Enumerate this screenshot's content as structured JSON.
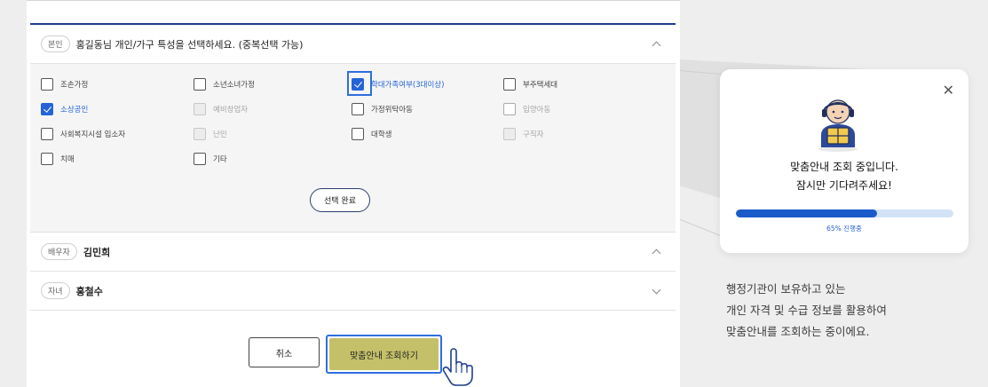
{
  "colors": {
    "accent": "#2563d9",
    "primary_button": "#c4c06a",
    "progress_fill": "#1a5bc9",
    "progress_track": "#d3e2f7"
  },
  "section1": {
    "tag": "본인",
    "title": "홍길동님 개인/가구 특성을 선택하세요. (중복선택 가능)",
    "options": [
      {
        "label": "조손가정",
        "checked": false,
        "disabled": false
      },
      {
        "label": "소년소녀가정",
        "checked": false,
        "disabled": false
      },
      {
        "label": "학대가족여부(3대이상)",
        "checked": true,
        "disabled": false
      },
      {
        "label": "부주택세대",
        "checked": false,
        "disabled": false
      },
      {
        "label": "소상공인",
        "checked": true,
        "disabled": false
      },
      {
        "label": "예비창업자",
        "checked": false,
        "disabled": true
      },
      {
        "label": "가정위탁아동",
        "checked": false,
        "disabled": false
      },
      {
        "label": "입양아동",
        "checked": false,
        "disabled": true
      },
      {
        "label": "사회복지시설 입소자",
        "checked": false,
        "disabled": false
      },
      {
        "label": "난민",
        "checked": false,
        "disabled": true
      },
      {
        "label": "대학생",
        "checked": false,
        "disabled": false
      },
      {
        "label": "구직자",
        "checked": false,
        "disabled": true
      },
      {
        "label": "치매",
        "checked": false,
        "disabled": false
      },
      {
        "label": "기타",
        "checked": false,
        "disabled": false
      }
    ],
    "done_label": "선택 완료"
  },
  "section2": {
    "tag": "배우자",
    "name": "김민희"
  },
  "section3": {
    "tag": "자녀",
    "name": "홍철수"
  },
  "buttons": {
    "cancel": "취소",
    "search": "맞춤안내 조회하기"
  },
  "popup": {
    "close_icon": "close-icon",
    "line1": "맞춤안내 조회 중입니다.",
    "line2": "잠시만 기다려주세요!",
    "progress": 0.65,
    "progress_label": "65% 진행중"
  },
  "description": [
    "행정기관이 보유하고 있는",
    "개인 자격 및 수급 정보를 활용하여",
    "맞춤안내를 조회하는 중이에요."
  ]
}
